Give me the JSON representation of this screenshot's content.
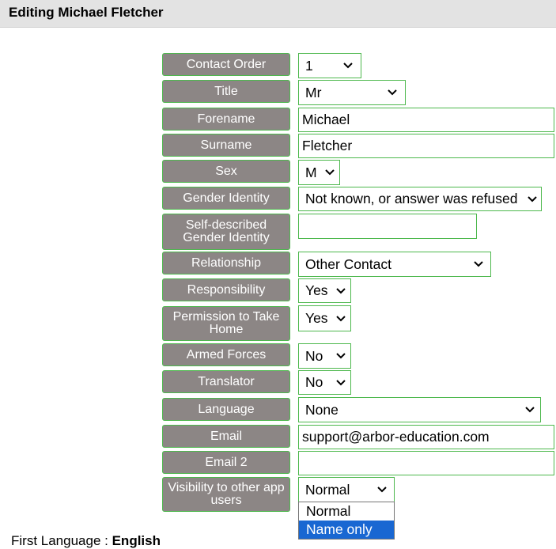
{
  "header": {
    "title": "Editing Michael Fletcher"
  },
  "fields": {
    "contact_order": {
      "label": "Contact Order",
      "value": "1"
    },
    "title": {
      "label": "Title",
      "value": "Mr"
    },
    "forename": {
      "label": "Forename",
      "value": "Michael"
    },
    "surname": {
      "label": "Surname",
      "value": "Fletcher"
    },
    "sex": {
      "label": "Sex",
      "value": "M"
    },
    "gender_identity": {
      "label": "Gender Identity",
      "value": "Not known, or answer was refused"
    },
    "self_described_gender": {
      "label_line1": "Self-described",
      "label_line2": "Gender Identity",
      "value": ""
    },
    "relationship": {
      "label": "Relationship",
      "value": "Other Contact"
    },
    "responsibility": {
      "label": "Responsibility",
      "value": "Yes"
    },
    "permission_take_home": {
      "label_line1": "Permission to Take",
      "label_line2": "Home",
      "value": "Yes"
    },
    "armed_forces": {
      "label": "Armed Forces",
      "value": "No"
    },
    "translator": {
      "label": "Translator",
      "value": "No"
    },
    "language": {
      "label": "Language",
      "value": "None"
    },
    "email": {
      "label": "Email",
      "value": "support@arbor-education.com"
    },
    "email2": {
      "label": "Email 2",
      "value": ""
    },
    "visibility": {
      "label_line1": "Visibility to other app",
      "label_line2": "users",
      "value": "Normal",
      "options": [
        "Normal",
        "Name only"
      ],
      "highlighted_option": "Name only"
    }
  },
  "below": {
    "label": "First Language :",
    "value": "English"
  },
  "colors": {
    "label_bg": "#8c8685",
    "field_border": "#4db84d",
    "header_bg": "#e3e3e3",
    "option_highlight": "#1967d2"
  },
  "icons": {
    "select_arrow": "chevron-down-icon"
  }
}
